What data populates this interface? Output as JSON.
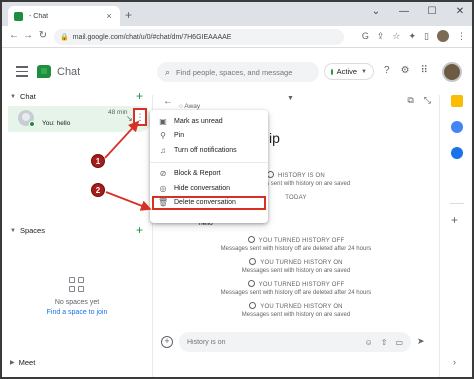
{
  "browser": {
    "tab_title": "- Chat",
    "tab_close": "×",
    "new_tab": "+",
    "window_controls": [
      "⌄",
      "—",
      "☐",
      "✕"
    ],
    "url": "mail.google.com/chat/u/0/#chat/dm/7H6GIEAAAAE"
  },
  "app": {
    "name": "Chat",
    "search_placeholder": "Find people, spaces, and message",
    "status": "Active",
    "accent": "#1e8e3e"
  },
  "sidebar": {
    "chat_header": "Chat",
    "dm": {
      "time": "48 min",
      "preview": "You: hello"
    },
    "spaces_header": "Spaces",
    "no_spaces": "No spaces yet",
    "find_space": "Find a space to join",
    "meet_header": "Meet"
  },
  "conversation": {
    "away": "Away",
    "title_fragment": "ip",
    "messages": [
      {
        "title": "HISTORY IS ON",
        "sub": "Messages sent with history on are saved"
      },
      {
        "title": "TODAY",
        "sub": ""
      },
      {
        "title": "YOU TURNED HISTORY OFF",
        "sub": "Messages sent with history off are deleted after 24 hours"
      },
      {
        "title": "YOU TURNED HISTORY ON",
        "sub": "Messages sent with history on are saved"
      },
      {
        "title": "YOU TURNED HISTORY OFF",
        "sub": "Messages sent with history off are deleted after 24 hours"
      },
      {
        "title": "YOU TURNED HISTORY ON",
        "sub": "Messages sent with history on are saved"
      }
    ],
    "hello": "hello",
    "compose_placeholder": "History is on"
  },
  "context_menu": {
    "items": [
      {
        "label": "Mark as unread",
        "icon": "mark-unread-icon"
      },
      {
        "label": "Pin",
        "icon": "pin-icon"
      },
      {
        "label": "Turn off notifications",
        "icon": "bell-off-icon"
      },
      {
        "label": "Block & Report",
        "icon": "block-icon"
      },
      {
        "label": "Hide conversation",
        "icon": "hide-icon"
      },
      {
        "label": "Delete conversation",
        "icon": "trash-icon"
      }
    ]
  },
  "annotations": {
    "step1": "1",
    "step2": "2",
    "highlight_color": "#d93025"
  }
}
